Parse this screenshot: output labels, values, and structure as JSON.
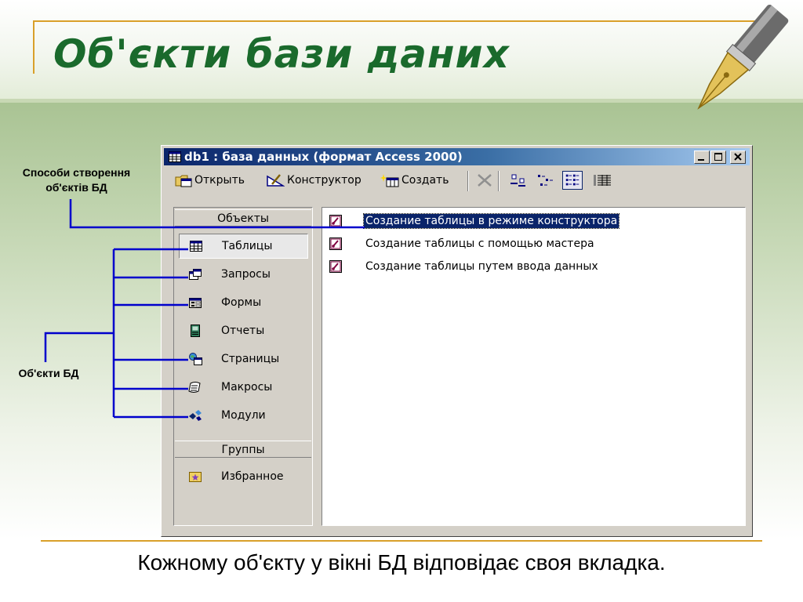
{
  "slide": {
    "title": "Об'єкти бази даних",
    "caption": "Кожному об'єкту у вікні БД відповідає своя вкладка.",
    "label_creation_methods": [
      "Способи створення",
      "об'єктів БД"
    ],
    "label_db_objects": "Об'єкти БД",
    "colors": {
      "title": "#1a6a2c",
      "accent_rule": "#d9a02a",
      "connector": "#0000cc"
    }
  },
  "window": {
    "title": "db1 : база данных (формат Access 2000)",
    "toolbar": {
      "open": "Открыть",
      "design": "Конструктор",
      "create": "Создать"
    },
    "objects_header": "Объекты",
    "objects": [
      {
        "label": "Таблицы",
        "icon": "table-icon",
        "selected": true
      },
      {
        "label": "Запросы",
        "icon": "query-icon",
        "selected": false
      },
      {
        "label": "Формы",
        "icon": "form-icon",
        "selected": false
      },
      {
        "label": "Отчеты",
        "icon": "report-icon",
        "selected": false
      },
      {
        "label": "Страницы",
        "icon": "page-icon",
        "selected": false
      },
      {
        "label": "Макросы",
        "icon": "macro-icon",
        "selected": false
      },
      {
        "label": "Модули",
        "icon": "module-icon",
        "selected": false
      }
    ],
    "groups_header": "Группы",
    "groups": [
      {
        "label": "Избранное",
        "icon": "favorites-icon"
      }
    ],
    "items": [
      {
        "label": "Создание таблицы в режиме конструктора",
        "selected": true
      },
      {
        "label": "Создание таблицы с помощью мастера",
        "selected": false
      },
      {
        "label": "Создание таблицы путем ввода данных",
        "selected": false
      }
    ]
  }
}
